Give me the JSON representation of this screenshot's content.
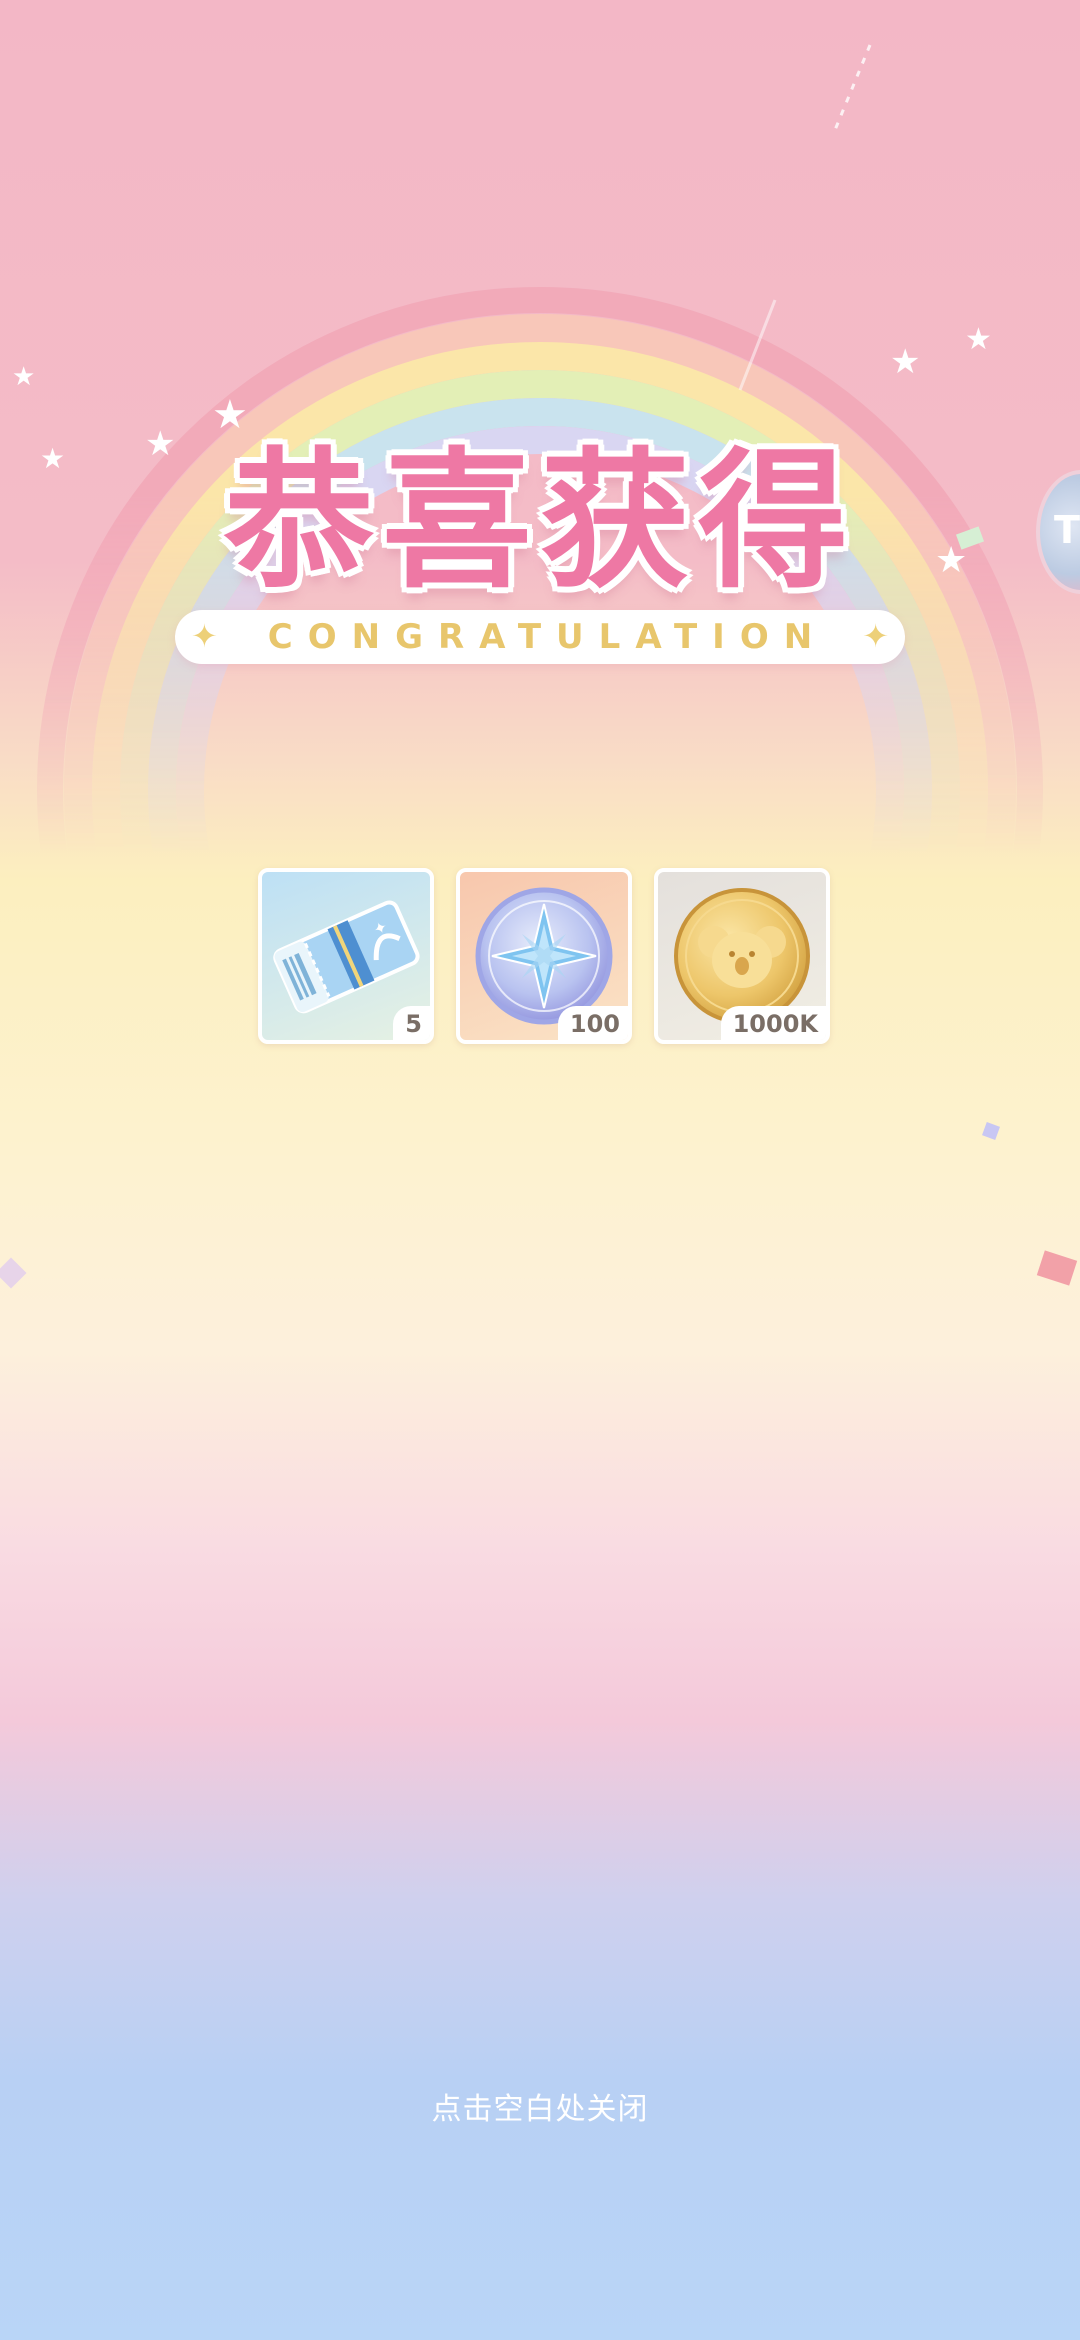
{
  "title": "恭喜获得",
  "subtitle": "CONGRATULATION",
  "rewards": [
    {
      "name": "ticket",
      "quantity": "5"
    },
    {
      "name": "star-coin",
      "quantity": "100"
    },
    {
      "name": "koala-gold-coin",
      "quantity": "1000K"
    }
  ],
  "close_hint": "点击空白处关闭",
  "side_button_label": "T",
  "icons": [
    "ticket-icon",
    "compass-star-coin-icon",
    "koala-coin-icon",
    "sparkle-icon"
  ],
  "colors": {
    "title_pink": "#ee78a4",
    "subtitle_gold": "#e8c66c",
    "bg_top": "#f3b7c6",
    "bg_bottom": "#b9d5f7"
  }
}
